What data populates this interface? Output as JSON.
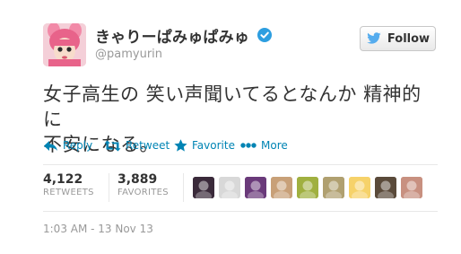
{
  "user": {
    "display_name": "きゃりーぱみゅぱみゅ",
    "screen_name": "@pamyurin",
    "verified": true
  },
  "follow_button": {
    "label": "Follow"
  },
  "tweet": {
    "lines": [
      "女子高生の 笑い声聞いてるとなんか 精神的に",
      "不安になる。"
    ]
  },
  "actions": {
    "reply": "Reply",
    "retweet": "Retweet",
    "favorite": "Favorite",
    "more": "More"
  },
  "stats": {
    "retweets": {
      "count": "4,122",
      "label": "RETWEETS"
    },
    "favorites": {
      "count": "3,889",
      "label": "FAVORITES"
    }
  },
  "favoriters": [
    {
      "icon": "user-avatar-1",
      "color": "#3a2a3a"
    },
    {
      "icon": "user-avatar-2",
      "color": "#d8d8d8"
    },
    {
      "icon": "user-avatar-3",
      "color": "#6a3a7a"
    },
    {
      "icon": "user-avatar-4",
      "color": "#c8a078"
    },
    {
      "icon": "user-avatar-5",
      "color": "#a0b040"
    },
    {
      "icon": "user-avatar-6",
      "color": "#b0a070"
    },
    {
      "icon": "user-avatar-7",
      "color": "#f6d26a"
    },
    {
      "icon": "user-avatar-8",
      "color": "#5a4a3a"
    },
    {
      "icon": "user-avatar-9",
      "color": "#c89080"
    }
  ],
  "timestamp": "1:03 AM - 13 Nov 13",
  "colors": {
    "link": "#0084b4",
    "verified": "#2d9ee0",
    "muted": "#999999",
    "text": "#333333"
  }
}
